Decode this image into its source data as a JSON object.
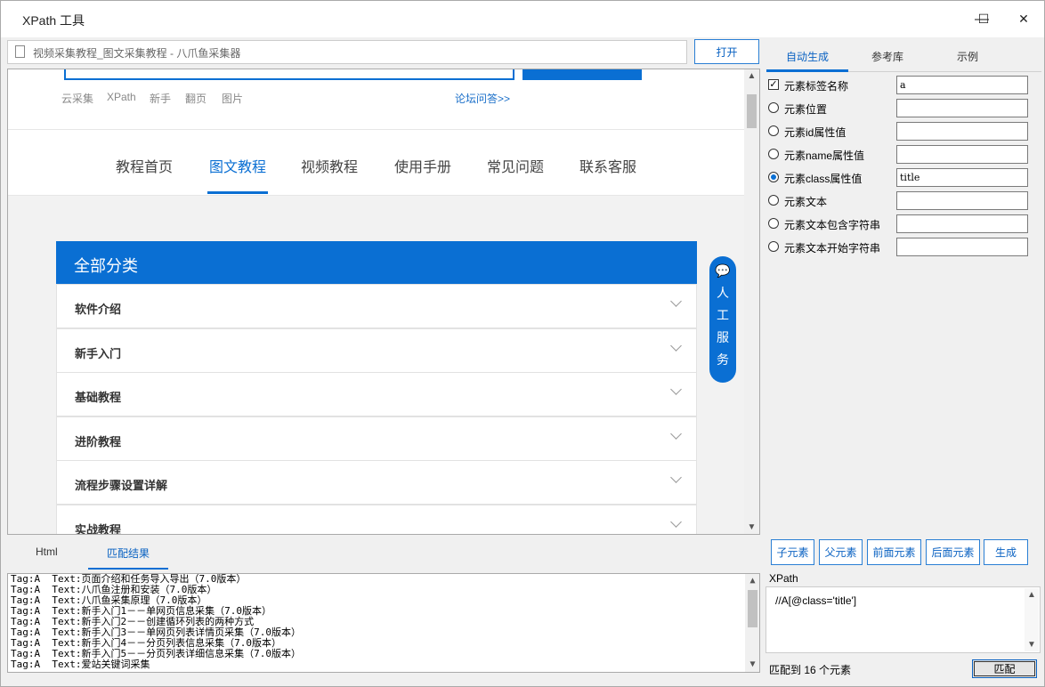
{
  "window": {
    "title": "XPath 工具",
    "minimize": "—",
    "maximize": "☐",
    "close": "✕"
  },
  "toolbar": {
    "url": "视频采集教程_图文采集教程 - 八爪鱼采集器",
    "open": "打开"
  },
  "page": {
    "nav": [
      "云采集",
      "XPath",
      "新手",
      "翻页",
      "图片"
    ],
    "forum": "论坛问答>>",
    "menu": [
      "教程首页",
      "图文教程",
      "视频教程",
      "使用手册",
      "常见问题",
      "联系客服"
    ],
    "all_categories": "全部分类",
    "categories": [
      "软件介绍",
      "新手入门",
      "基础教程",
      "进阶教程",
      "流程步骤设置详解",
      "实战教程"
    ],
    "service": [
      "人",
      "工",
      "服",
      "务"
    ]
  },
  "bottom_tabs": {
    "html": "Html",
    "match": "匹配结果"
  },
  "results": [
    "Tag:A  Text:页面介绍和任务导入导出（7.0版本）",
    "Tag:A  Text:八爪鱼注册和安装（7.0版本）",
    "Tag:A  Text:八爪鱼采集原理（7.0版本）",
    "Tag:A  Text:新手入门1－－单网页信息采集（7.0版本）",
    "Tag:A  Text:新手入门2－－创建循环列表的两种方式",
    "Tag:A  Text:新手入门3－－单网页列表详情页采集（7.0版本）",
    "Tag:A  Text:新手入门4－－分页列表信息采集（7.0版本）",
    "Tag:A  Text:新手入门5－－分页列表详细信息采集（7.0版本）",
    "Tag:A  Text:爱站关键词采集"
  ],
  "right_tabs": {
    "auto": "自动生成",
    "ref": "参考库",
    "example": "示例"
  },
  "options": [
    {
      "label": "元素标签名称",
      "value": "a",
      "type": "checkbox",
      "checked": true
    },
    {
      "label": "元素位置",
      "value": "",
      "type": "radio",
      "checked": false
    },
    {
      "label": "元素id属性值",
      "value": "",
      "type": "radio",
      "checked": false
    },
    {
      "label": "元素name属性值",
      "value": "",
      "type": "radio",
      "checked": false
    },
    {
      "label": "元素class属性值",
      "value": "title",
      "type": "radio",
      "checked": true
    },
    {
      "label": "元素文本",
      "value": "",
      "type": "radio",
      "checked": false
    },
    {
      "label": "元素文本包含字符串",
      "value": "",
      "type": "radio",
      "checked": false
    },
    {
      "label": "元素文本开始字符串",
      "value": "",
      "type": "radio",
      "checked": false
    }
  ],
  "actions": {
    "child": "子元素",
    "parent": "父元素",
    "prev": "前面元素",
    "next": "后面元素",
    "generate": "生成"
  },
  "xpath": {
    "label": "XPath",
    "value": "//A[@class='title']",
    "status": "匹配到 16 个元素",
    "match": "匹配"
  },
  "colors": {
    "accent": "#0a6fd3"
  }
}
